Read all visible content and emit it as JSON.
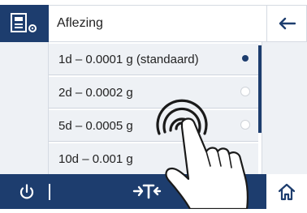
{
  "header": {
    "title": "Aflezing",
    "icons": {
      "app": "balance-settings-icon",
      "back": "arrow-left-icon"
    }
  },
  "list": {
    "items": [
      {
        "label": "1d – 0.0001 g (standaard)",
        "selected": true
      },
      {
        "label": "2d – 0.0002 g",
        "selected": false
      },
      {
        "label": "5d – 0.0005 g",
        "selected": false
      },
      {
        "label": "10d – 0.001 g",
        "selected": false
      }
    ]
  },
  "footer": {
    "icons": {
      "power": "power-icon",
      "tare": "tare-icon",
      "home": "home-icon"
    }
  },
  "overlay": {
    "icon": "tap-gesture-hand-icon"
  },
  "colors": {
    "brand": "#1d3d6e",
    "panel": "#eef1f5",
    "divider": "#d5dae2"
  }
}
